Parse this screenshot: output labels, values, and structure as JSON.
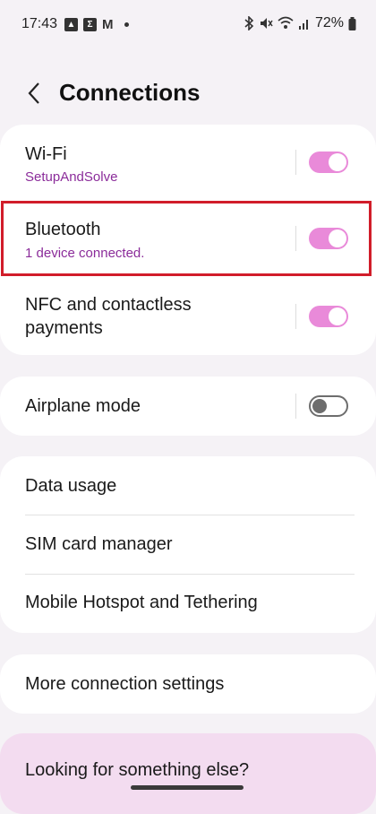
{
  "status_bar": {
    "time": "17:43",
    "battery": "72%"
  },
  "header": {
    "title": "Connections"
  },
  "connections": {
    "wifi": {
      "title": "Wi-Fi",
      "subtitle": "SetupAndSolve",
      "enabled": true
    },
    "bluetooth": {
      "title": "Bluetooth",
      "subtitle": "1 device connected.",
      "enabled": true
    },
    "nfc": {
      "title_line1": "NFC and contactless",
      "title_line2": "payments",
      "enabled": true
    }
  },
  "airplane": {
    "title": "Airplane mode",
    "enabled": false
  },
  "data_group": {
    "items": [
      "Data usage",
      "SIM card manager",
      "Mobile Hotspot and Tethering"
    ]
  },
  "more": {
    "title": "More connection settings"
  },
  "suggest": {
    "title": "Looking for something else?"
  },
  "colors": {
    "accent": "#e98ad9",
    "subtitle": "#8b2c9a",
    "highlight": "#d11d2a"
  }
}
